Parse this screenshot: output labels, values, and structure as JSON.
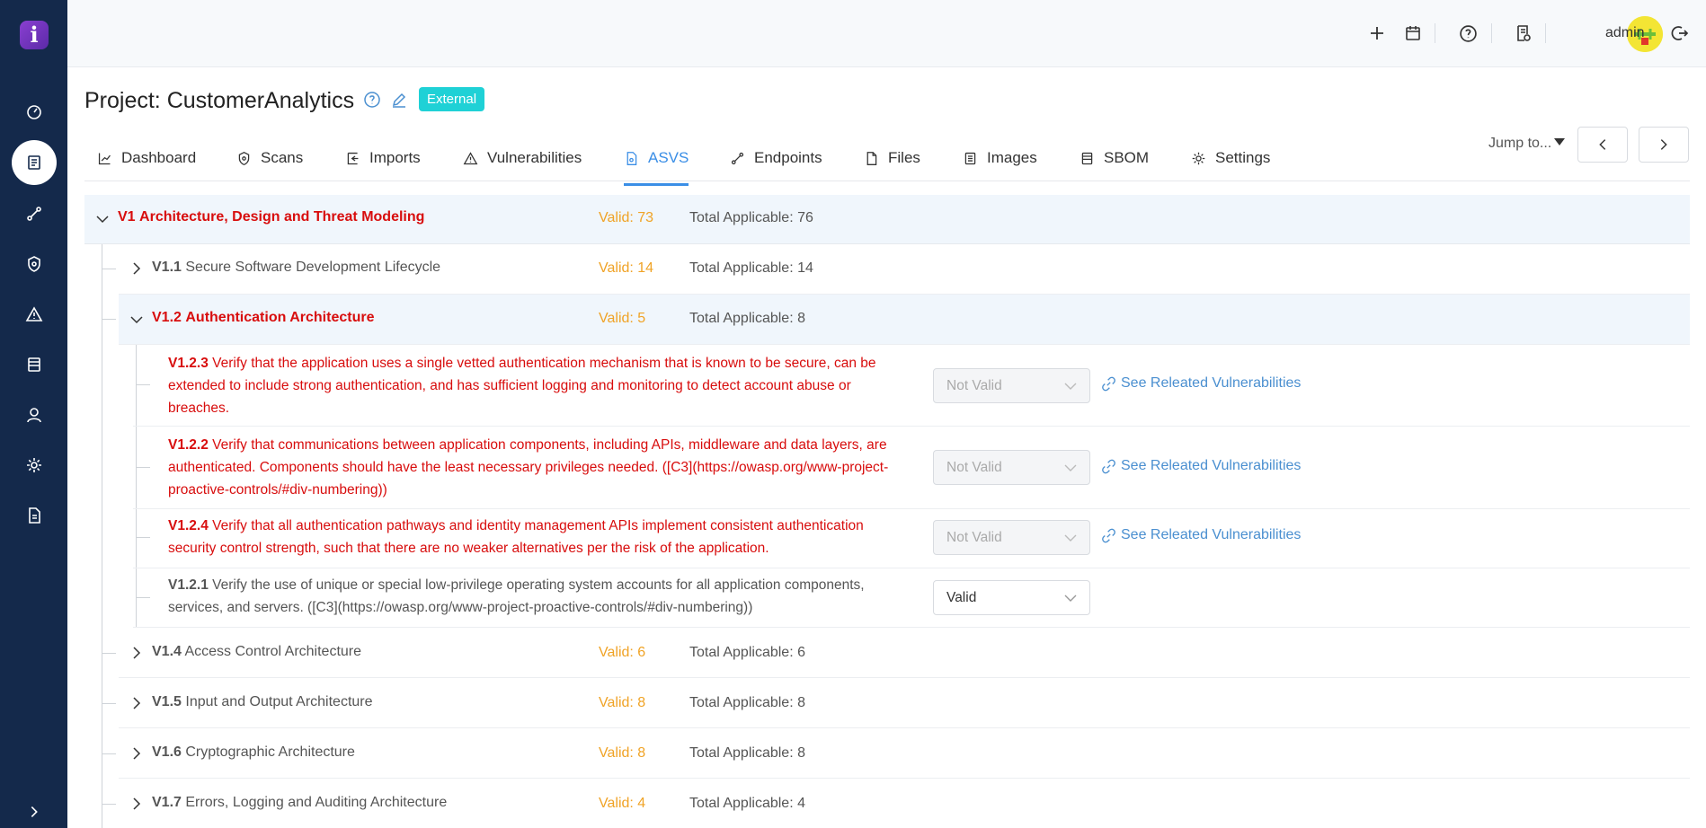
{
  "app": {
    "logo_letter": "i"
  },
  "header": {
    "user_name": "admin"
  },
  "project": {
    "title": "Project: CustomerAnalytics",
    "badge": "External"
  },
  "tabs": [
    {
      "label": "Dashboard",
      "icon": "chart-icon"
    },
    {
      "label": "Scans",
      "icon": "shield-icon"
    },
    {
      "label": "Imports",
      "icon": "import-icon"
    },
    {
      "label": "Vulnerabilities",
      "icon": "warning-icon"
    },
    {
      "label": "ASVS",
      "icon": "asvs-icon",
      "active": true
    },
    {
      "label": "Endpoints",
      "icon": "endpoint-icon"
    },
    {
      "label": "Files",
      "icon": "file-icon"
    },
    {
      "label": "Images",
      "icon": "image-icon"
    },
    {
      "label": "SBOM",
      "icon": "sbom-icon"
    },
    {
      "label": "Settings",
      "icon": "gear-icon"
    }
  ],
  "jump_to": "Jump to...",
  "tree": {
    "v1": {
      "code": "V1",
      "title": "Architecture, Design and Threat Modeling",
      "valid": "Valid: 73",
      "total": "Total Applicable: 76"
    },
    "sections": [
      {
        "code": "V1.1",
        "title": "Secure Software Development Lifecycle",
        "valid": "Valid: 14",
        "total": "Total Applicable: 14"
      },
      {
        "code": "V1.2",
        "title": "Authentication Architecture",
        "valid": "Valid: 5",
        "total": "Total Applicable: 8"
      },
      {
        "code": "V1.4",
        "title": "Access Control Architecture",
        "valid": "Valid: 6",
        "total": "Total Applicable: 6"
      },
      {
        "code": "V1.5",
        "title": "Input and Output Architecture",
        "valid": "Valid: 8",
        "total": "Total Applicable: 8"
      },
      {
        "code": "V1.6",
        "title": "Cryptographic Architecture",
        "valid": "Valid: 8",
        "total": "Total Applicable: 8"
      },
      {
        "code": "V1.7",
        "title": "Errors, Logging and Auditing Architecture",
        "valid": "Valid: 4",
        "total": "Total Applicable: 4"
      }
    ],
    "requirements": [
      {
        "code": "V1.2.3",
        "text": "Verify that the application uses a single vetted authentication mechanism that is known to be secure, can be extended to include strong authentication, and has sufficient logging and monitoring to detect account abuse or breaches.",
        "status": "Not Valid",
        "link": "See Releated Vulnerabilities"
      },
      {
        "code": "V1.2.2",
        "text": "Verify that communications between application components, including APIs, middleware and data layers, are authenticated. Components should have the least necessary privileges needed. ([C3](https://owasp.org/www-project-proactive-controls/#div-numbering))",
        "status": "Not Valid",
        "link": "See Releated Vulnerabilities"
      },
      {
        "code": "V1.2.4",
        "text": "Verify that all authentication pathways and identity management APIs implement consistent authentication security control strength, such that there are no weaker alternatives per the risk of the application.",
        "status": "Not Valid",
        "link": "See Releated Vulnerabilities"
      },
      {
        "code": "V1.2.1",
        "text": "Verify the use of unique or special low-privilege operating system accounts for all application components, services, and servers. ([C3](https://owasp.org/www-project-proactive-controls/#div-numbering))",
        "status": "Valid"
      }
    ]
  },
  "colors": {
    "sidebar": "#14294b",
    "accent": "#3a8ee6",
    "error": "#d80d0d",
    "valid": "#f0a326",
    "badge": "#1fd1d6"
  }
}
